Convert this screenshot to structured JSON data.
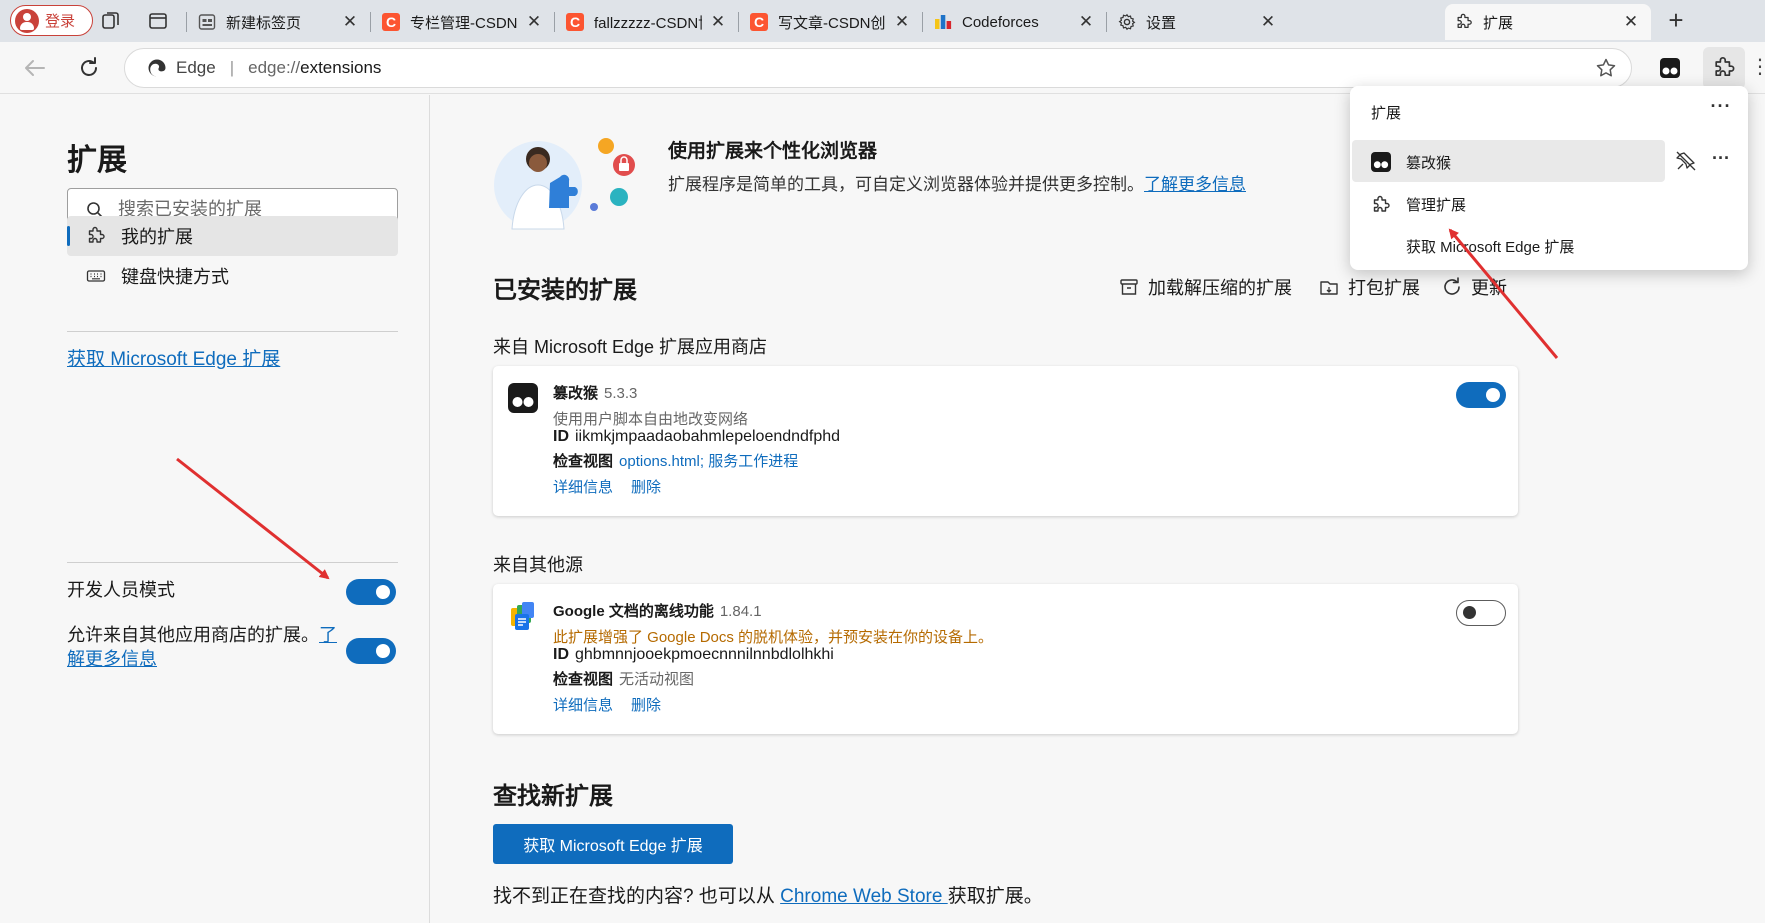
{
  "tabstrip": {
    "login_label": "登录",
    "tabs": [
      {
        "title": "新建标签页",
        "icon": "new-tab-page-icon"
      },
      {
        "title": "专栏管理-CSDN创作",
        "icon": "csdn-icon"
      },
      {
        "title": "fallzzzzz-CSDN博客",
        "icon": "csdn-icon"
      },
      {
        "title": "写文章-CSDN创作中",
        "icon": "csdn-icon"
      },
      {
        "title": "Codeforces",
        "icon": "codeforces-icon"
      },
      {
        "title": "设置",
        "icon": "gear-icon"
      },
      {
        "title": "扩展",
        "icon": "puzzle-icon"
      }
    ],
    "close_glyph": "✕",
    "new_tab_glyph": "+",
    "csdn_glyph": "C"
  },
  "toolbar": {
    "brand": "Edge",
    "url_scheme": "edge://",
    "url_path": "extensions"
  },
  "sidebar": {
    "title": "扩展",
    "search_placeholder": "搜索已安装的扩展",
    "items": [
      {
        "label": "我的扩展",
        "icon": "puzzle-icon",
        "selected": true
      },
      {
        "label": "键盘快捷方式",
        "icon": "keyboard-icon",
        "selected": false
      }
    ],
    "get_link": "获取 Microsoft Edge 扩展",
    "dev_mode_label": "开发人员模式",
    "dev_mode_on": true,
    "allow_other_label": "允许来自其他应用商店的扩展。",
    "allow_other_link": "了解更多信息",
    "allow_other_on": true
  },
  "hero": {
    "title": "使用扩展来个性化浏览器",
    "desc": "扩展程序是简单的工具，可自定义浏览器体验并提供更多控制。",
    "link": "了解更多信息"
  },
  "installed": {
    "title": "已安装的扩展",
    "actions": [
      {
        "label": "加载解压缩的扩展",
        "icon": "load-unpacked-icon"
      },
      {
        "label": "打包扩展",
        "icon": "pack-icon"
      },
      {
        "label": "更新",
        "icon": "refresh-icon"
      }
    ],
    "from_store_label": "来自 Microsoft Edge 扩展应用商店",
    "from_other_label": "来自其他源"
  },
  "extensions": [
    {
      "name": "篡改猴",
      "version": "5.3.3",
      "description": "使用用户脚本自由地改变网络",
      "id_label": "ID",
      "id": "iikmkjmpaadaobahmlepeloendndfphd",
      "view_label": "检查视图",
      "views": "options.html; 服务工作进程",
      "details_label": "详细信息",
      "remove_label": "删除",
      "enabled": true,
      "icon": "tampermonkey-icon"
    },
    {
      "name": "Google 文档的离线功能",
      "version": "1.84.1",
      "description": "此扩展增强了 Google Docs 的脱机体验，并预安装在你的设备上。",
      "id_label": "ID",
      "id": "ghbmnnjooekpmoecnnnilnnbdlolhkhi",
      "view_label": "检查视图",
      "views": "无活动视图",
      "details_label": "详细信息",
      "remove_label": "删除",
      "enabled": false,
      "icon": "google-docs-offline-icon"
    }
  ],
  "find_new": {
    "title": "查找新扩展",
    "button": "获取 Microsoft Edge 扩展",
    "footer_prefix": "找不到正在查找的内容? 也可以从 ",
    "footer_link": "Chrome Web Store ",
    "footer_suffix": "获取扩展。"
  },
  "popup": {
    "title": "扩展",
    "more_glyph": "···",
    "ext_name": "篡改猴",
    "manage_label": "管理扩展",
    "get_label": "获取 Microsoft Edge 扩展"
  },
  "colors": {
    "accent": "#0f6cbd",
    "annotation_arrow": "#e03030",
    "csdn": "#fc5531",
    "login": "#c9423a"
  }
}
